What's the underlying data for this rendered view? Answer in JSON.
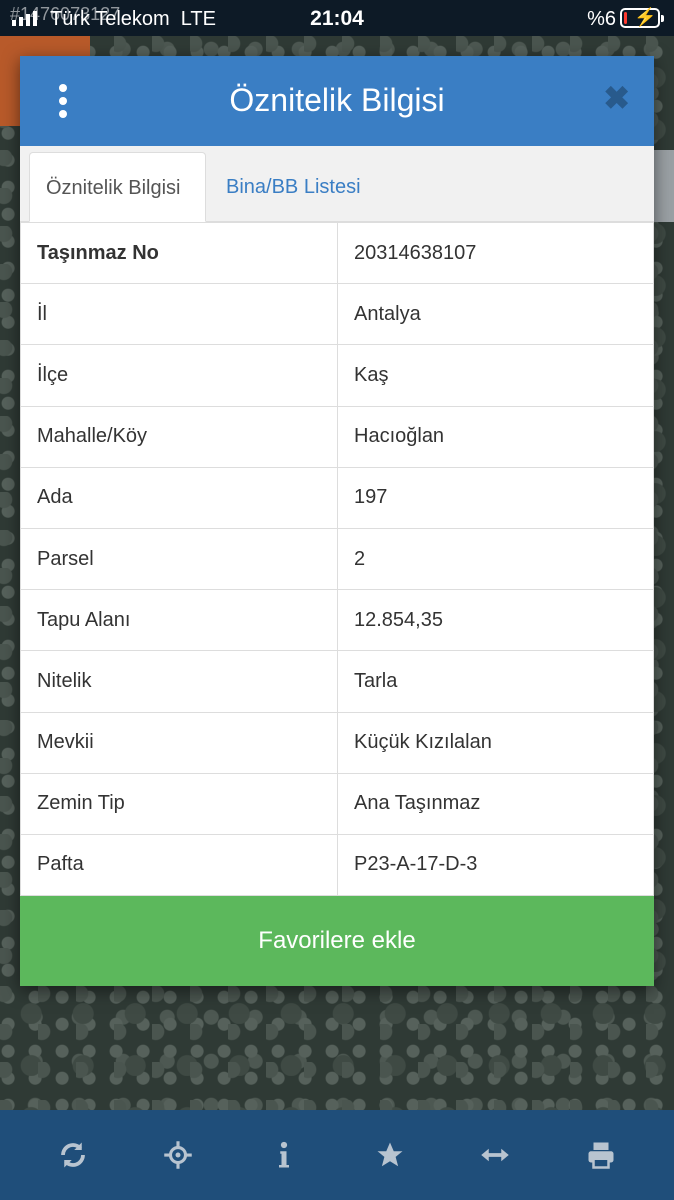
{
  "status_bar": {
    "carrier": "Türk Telekom",
    "network": "LTE",
    "time": "21:04",
    "battery_percent": "%6",
    "battery_level": 0.06,
    "watermark": "#1476073127"
  },
  "modal": {
    "title": "Öznitelik Bilgisi",
    "tabs": [
      {
        "label": "Öznitelik Bilgisi",
        "active": true
      },
      {
        "label": "Bina/BB Listesi",
        "active": false
      }
    ],
    "rows": [
      {
        "key": "Taşınmaz No",
        "value": "20314638107"
      },
      {
        "key": "İl",
        "value": "Antalya"
      },
      {
        "key": "İlçe",
        "value": "Kaş"
      },
      {
        "key": "Mahalle/Köy",
        "value": "Hacıoğlan"
      },
      {
        "key": "Ada",
        "value": "197"
      },
      {
        "key": "Parsel",
        "value": "2"
      },
      {
        "key": "Tapu Alanı",
        "value": "12.854,35"
      },
      {
        "key": "Nitelik",
        "value": "Tarla"
      },
      {
        "key": "Mevkii",
        "value": "Küçük Kızılalan"
      },
      {
        "key": "Zemin Tip",
        "value": "Ana Taşınmaz"
      },
      {
        "key": "Pafta",
        "value": "P23-A-17-D-3"
      }
    ],
    "favorite_button": "Favorilere ekle"
  },
  "toolbar": {
    "icons": [
      "refresh-icon",
      "locate-icon",
      "info-icon",
      "star-icon",
      "measure-icon",
      "print-icon"
    ]
  },
  "colors": {
    "header": "#3a7ec4",
    "favorite": "#5cb85c",
    "toolbar": "#1f4e7a"
  }
}
